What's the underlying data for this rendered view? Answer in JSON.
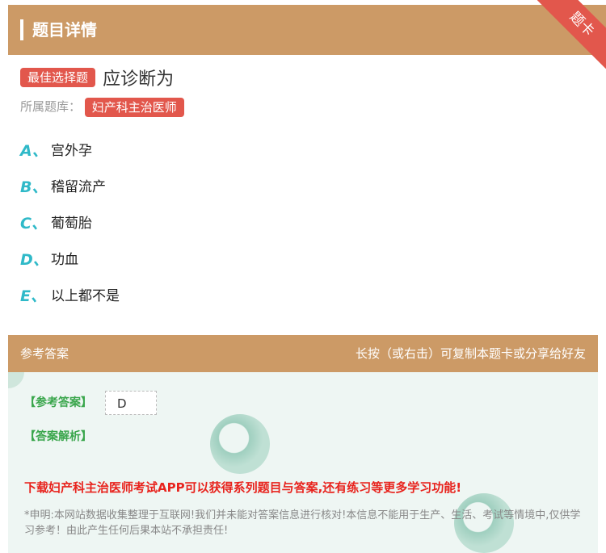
{
  "header": {
    "title": "题目详情",
    "ribbon": "题卡"
  },
  "question": {
    "type_tag": "最佳选择题",
    "stem": "应诊断为",
    "bank_label": "所属题库：",
    "bank_tag": "妇产科主治医师"
  },
  "options": [
    {
      "letter": "A、",
      "text": "宫外孕"
    },
    {
      "letter": "B、",
      "text": "稽留流产"
    },
    {
      "letter": "C、",
      "text": "葡萄胎"
    },
    {
      "letter": "D、",
      "text": "功血"
    },
    {
      "letter": "E、",
      "text": "以上都不是"
    }
  ],
  "answer_section": {
    "title": "参考答案",
    "hint": "长按（或右击）可复制本题卡或分享给好友",
    "ref_label": "【参考答案】",
    "ref_value": "D",
    "analysis_label": "【答案解析】",
    "promo": "下载妇产科主治医师考试APP可以获得系列题目与答案,还有练习等更多学习功能!",
    "notice": "*申明:本网站数据收集整理于互联网!我们并未能对答案信息进行核对!本信息不能用于生产、生活、考试等情境中,仅供学习参考！由此产生任何后果本站不承担责任!"
  },
  "colors": {
    "header": "#cc9a66",
    "tag": "#e2574c",
    "option_letter": "#2fb9c8",
    "promo": "#e8231d",
    "label_green": "#3aa64c"
  }
}
